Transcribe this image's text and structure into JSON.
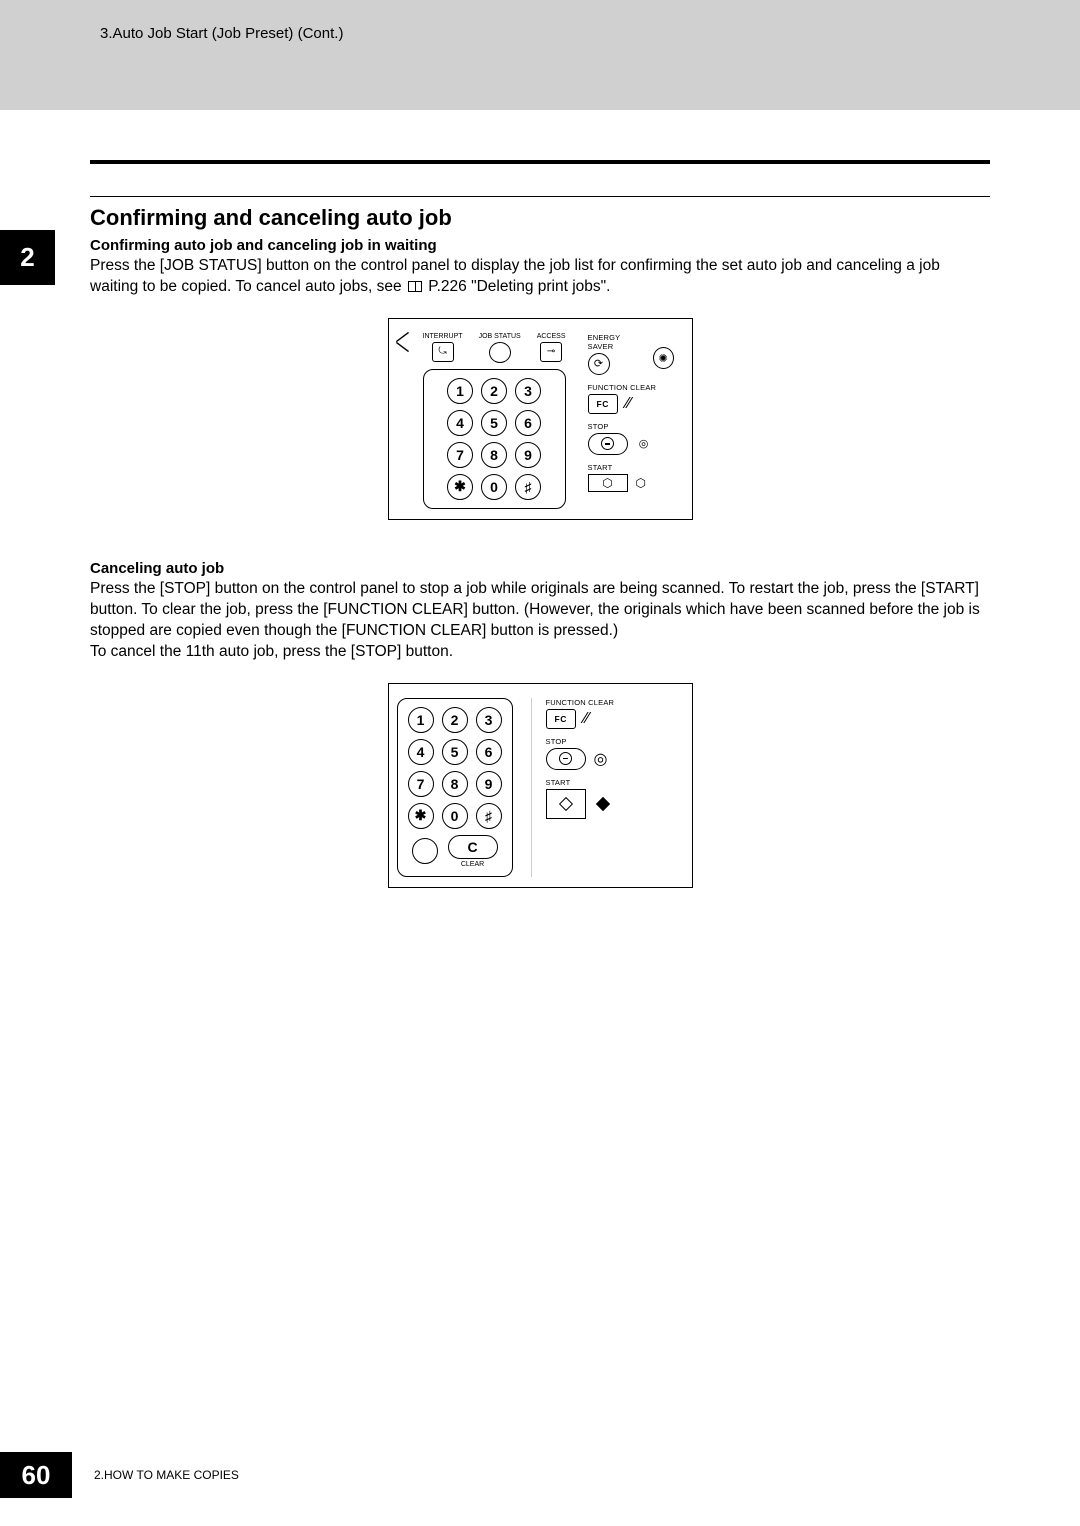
{
  "header": {
    "breadcrumb": "3.Auto Job Start (Job Preset) (Cont.)"
  },
  "chapter_tab": "2",
  "section": {
    "title": "Confirming and canceling auto job"
  },
  "block1": {
    "heading": "Confirming auto job and canceling job in waiting",
    "text_a": "Press the [JOB STATUS] button on the control panel to display the job list for confirming the set auto job and canceling a job waiting to be copied. To cancel auto jobs, see ",
    "text_b": " P.226 \"Deleting print jobs\"."
  },
  "block2": {
    "heading": "Canceling auto job",
    "text": "Press the [STOP] button on the control panel to stop a job while originals are being scanned. To restart the job, press the [START] button. To clear the job, press the [FUNCTION CLEAR] button. (However, the originals which have been scanned before the job is stopped are copied even though the [FUNCTION CLEAR] button is pressed.)\nTo cancel the 11th auto job, press the [STOP] button."
  },
  "panel_labels": {
    "interrupt": "INTERRUPT",
    "job_status": "JOB STATUS",
    "access": "ACCESS",
    "energy_saver": "ENERGY SAVER",
    "function_clear": "FUNCTION CLEAR",
    "fc": "FC",
    "stop": "STOP",
    "start": "START",
    "clear": "CLEAR"
  },
  "keypad": {
    "k1": "1",
    "k2": "2",
    "k3": "3",
    "k4": "4",
    "k5": "5",
    "k6": "6",
    "k7": "7",
    "k8": "8",
    "k9": "9",
    "kstar": "✱",
    "k0": "0",
    "khash": "♯",
    "kc": "C"
  },
  "footer": {
    "page": "60",
    "chapter": "2.HOW TO MAKE COPIES"
  }
}
